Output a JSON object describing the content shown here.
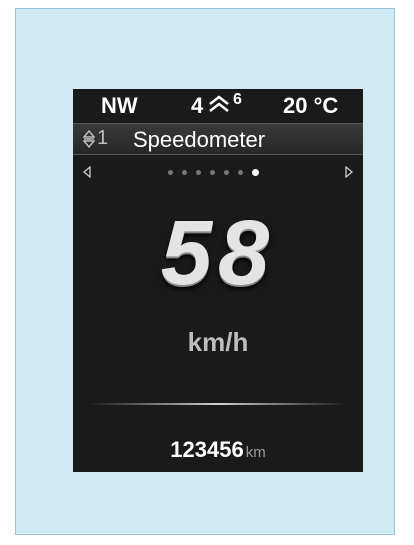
{
  "status_bar": {
    "direction": "NW",
    "assist_level": "4",
    "assist_icon": "mountain-peaks-icon",
    "gear": "6",
    "temperature": "20 °C"
  },
  "header": {
    "sort_icon": "up-down-arrows-icon",
    "number": "1",
    "title": "Speedometer"
  },
  "pager": {
    "left_icon": "left-triangle-icon",
    "right_icon": "right-triangle-icon",
    "dot_count": 7,
    "active_dot": 7
  },
  "speed": {
    "value": "58",
    "unit": "km/h"
  },
  "odometer": {
    "value": "123456",
    "unit": "km"
  },
  "colors": {
    "panel_bg": "#cfe9f5",
    "display_bg": "#1a1a1a",
    "text_primary": "#ffffff",
    "text_secondary": "#bdbdbd"
  }
}
